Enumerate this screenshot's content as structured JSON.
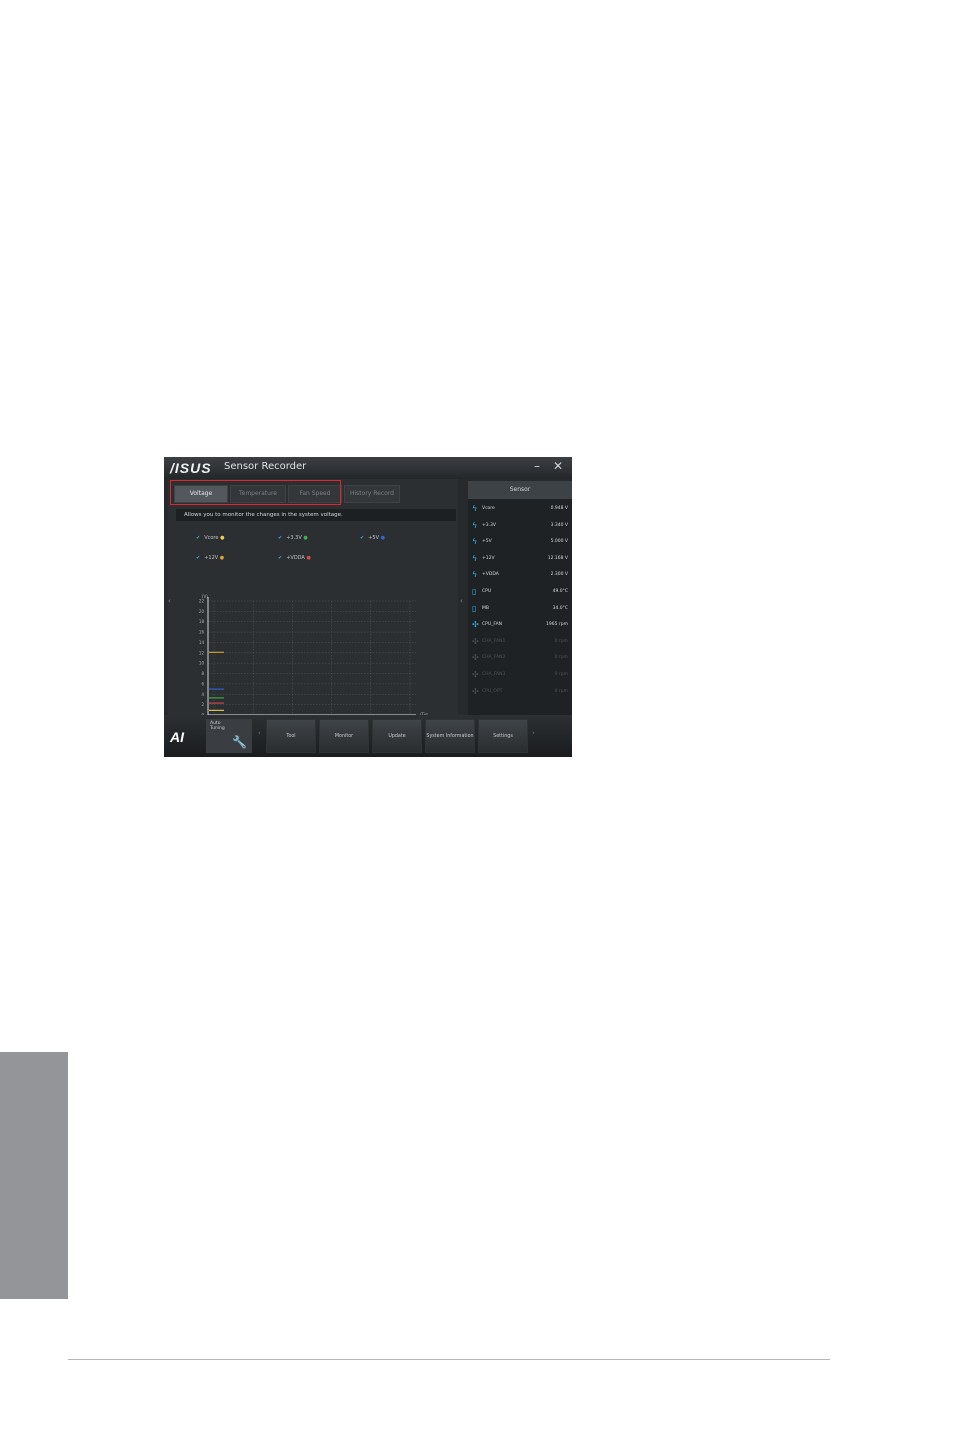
{
  "window": {
    "brand": "/ISUS",
    "title": "Sensor Recorder",
    "minimize": "–",
    "close": "✕"
  },
  "tabs": [
    {
      "label": "Voltage",
      "active": true
    },
    {
      "label": "Temperature",
      "active": false
    },
    {
      "label": "Fan Speed",
      "active": false
    },
    {
      "label": "History Record",
      "active": false
    }
  ],
  "description": "Allows you to monitor the changes in the system voltage.",
  "legend": [
    {
      "label": "Vcore",
      "color": "#e8d44a"
    },
    {
      "label": "+3.3V",
      "color": "#3db34a"
    },
    {
      "label": "+5V",
      "color": "#2e66d8"
    },
    {
      "label": "+12V",
      "color": "#e0a030"
    },
    {
      "label": "+VDDA",
      "color": "#d84a4a"
    }
  ],
  "chart_data": {
    "type": "line",
    "ylabel": "(V)",
    "xlabel": "(Time)",
    "ylim": [
      0,
      22
    ],
    "y_ticks": [
      0,
      2,
      4,
      6,
      8,
      10,
      12,
      14,
      16,
      18,
      20,
      22
    ],
    "x_ticks": [
      "00:00:00",
      "00:00:00",
      "00:00:00",
      "00:00:00",
      "00:00:00",
      "00:00:00"
    ],
    "series": [
      {
        "name": "Vcore",
        "values": [
          0.9
        ]
      },
      {
        "name": "+3.3V",
        "values": [
          3.3
        ]
      },
      {
        "name": "+5V",
        "values": [
          5.0
        ]
      },
      {
        "name": "+12V",
        "values": [
          12.1
        ]
      },
      {
        "name": "+VDDA",
        "values": [
          2.3
        ]
      }
    ],
    "controls": "X 100%   Y 100%"
  },
  "sensor_panel": {
    "header": "Sensor",
    "rows": [
      {
        "icon": "voltage-icon",
        "name": "Vcore",
        "value": "0.948 V",
        "enabled": true
      },
      {
        "icon": "voltage-icon",
        "name": "+3.3V",
        "value": "3.340 V",
        "enabled": true
      },
      {
        "icon": "voltage-icon",
        "name": "+5V",
        "value": "5.000 V",
        "enabled": true
      },
      {
        "icon": "voltage-icon",
        "name": "+12V",
        "value": "12.168 V",
        "enabled": true
      },
      {
        "icon": "voltage-icon",
        "name": "+VDDA",
        "value": "2.300 V",
        "enabled": true
      },
      {
        "icon": "temperature-icon",
        "name": "CPU",
        "value": "49.0°C",
        "enabled": true
      },
      {
        "icon": "temperature-icon",
        "name": "MB",
        "value": "34.0°C",
        "enabled": true
      },
      {
        "icon": "fan-icon",
        "name": "CPU_FAN",
        "value": "1965 rpm",
        "enabled": true
      },
      {
        "icon": "fan-icon",
        "name": "CHA_FAN1",
        "value": "0 rpm",
        "enabled": false
      },
      {
        "icon": "fan-icon",
        "name": "CHA_FAN2",
        "value": "0 rpm",
        "enabled": false
      },
      {
        "icon": "fan-icon",
        "name": "CHA_FAN3",
        "value": "0 rpm",
        "enabled": false
      },
      {
        "icon": "fan-icon",
        "name": "CPU_OPT",
        "value": "0 rpm",
        "enabled": false
      }
    ]
  },
  "bottom_bar": {
    "logo": "AI",
    "quick_tuning": "Auto Tuning",
    "nav": [
      "Tool",
      "Monitor",
      "Update",
      "System Information",
      "Settings"
    ]
  }
}
